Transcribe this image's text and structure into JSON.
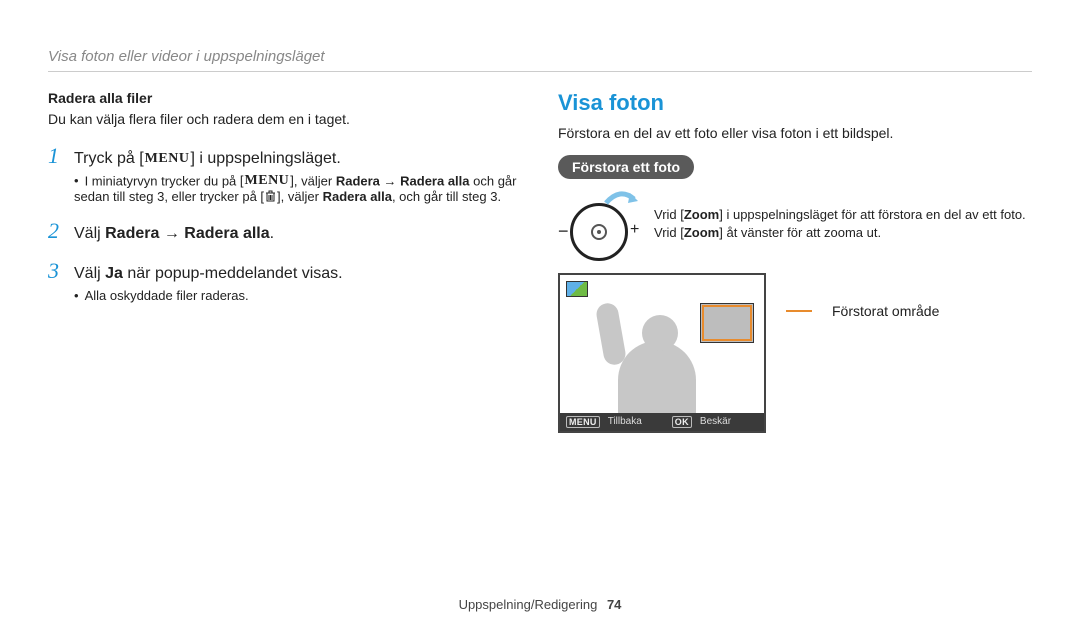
{
  "header": {
    "title": "Visa foton eller videor i uppspelningsläget"
  },
  "left": {
    "subhead": "Radera alla filer",
    "intro": "Du kan välja flera filer och radera dem en i taget.",
    "steps": [
      {
        "num": "1",
        "pre": "Tryck på ",
        "menu": "m",
        "post": " i uppspelningsläget.",
        "notes": [
          {
            "pre": "I miniatyrvyn trycker du på ",
            "menu": "m",
            "mid": ", väljer ",
            "bold1": "Radera",
            "arrow": " → ",
            "bold2": "Radera alla",
            "post1": " och går sedan till steg 3, eller trycker på ",
            "trash": true,
            "post2": ", väljer ",
            "bold3": "Radera alla",
            "post3": ", och går till steg 3."
          }
        ]
      },
      {
        "num": "2",
        "pre": "Välj ",
        "bold1": "Radera",
        "arrow": " → ",
        "bold2": "Radera alla",
        "post": "."
      },
      {
        "num": "3",
        "pre": "Välj ",
        "bold1": "Ja",
        "post": " när popup-meddelandet visas.",
        "notes": [
          {
            "plain": "Alla oskyddade filer raderas."
          }
        ]
      }
    ]
  },
  "right": {
    "title": "Visa foton",
    "intro": "Förstora en del av ett foto eller visa foton i ett bildspel.",
    "pill": "Förstora ett foto",
    "zoom": {
      "line1_pre": "Vrid [",
      "line1_bold": "Zoom",
      "line1_post": "] i uppspelningsläget för att förstora en del av ett foto.",
      "line2_pre": "Vrid [",
      "line2_bold": "Zoom",
      "line2_post": "] åt vänster för att zooma ut.",
      "minus": "−",
      "plus": "+"
    },
    "screen": {
      "key1": "MENU",
      "label1": "Tillbaka",
      "key2": "OK",
      "label2": "Beskär"
    },
    "callout": "Förstorat område"
  },
  "footer": {
    "section": "Uppspelning/Redigering",
    "page": "74"
  }
}
